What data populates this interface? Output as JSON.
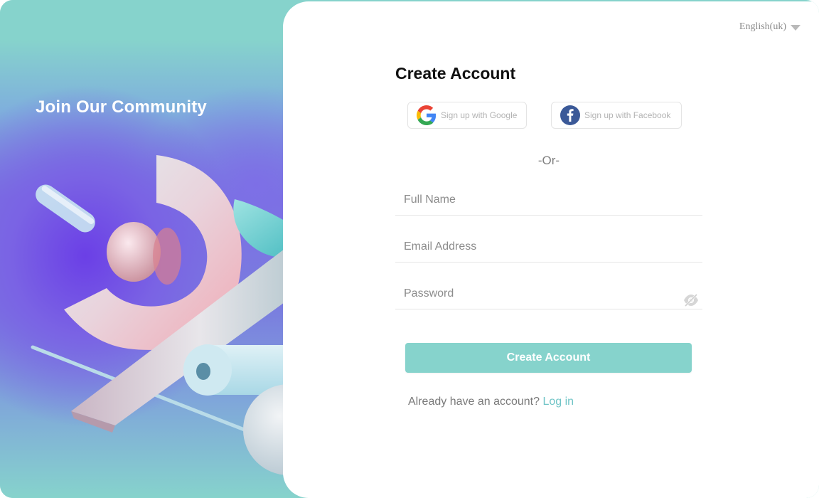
{
  "left_panel": {
    "title": "Join Our Community"
  },
  "header": {
    "language": "English(uk)"
  },
  "form": {
    "heading": "Create Account",
    "google_label": "Sign up with Google",
    "facebook_label": "Sign up with Facebook",
    "divider": "-Or-",
    "full_name_placeholder": "Full Name",
    "email_placeholder": "Email Address",
    "password_placeholder": "Password",
    "submit_label": "Create Account",
    "login_prompt": "Already have an account?",
    "login_link": "Log in"
  },
  "colors": {
    "accent": "#86d3cc",
    "link": "#6fc4c6",
    "facebook": "#3b5998"
  },
  "icons": [
    "google-icon",
    "facebook-icon",
    "eye-off-icon",
    "chevron-down-icon"
  ]
}
